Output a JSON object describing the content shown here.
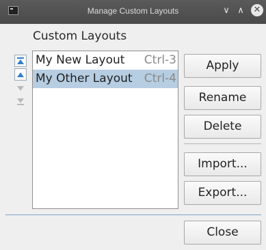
{
  "window": {
    "title": "Manage Custom Layouts",
    "minimize_glyph": "∨",
    "maximize_glyph": "∧",
    "close_glyph": "✕"
  },
  "heading": "Custom Layouts",
  "layouts": [
    {
      "name": "My New Layout",
      "shortcut": "Ctrl-3",
      "selected": false
    },
    {
      "name": "My Other Layout",
      "shortcut": "Ctrl-4",
      "selected": true
    }
  ],
  "buttons": {
    "apply": "Apply",
    "rename": "Rename",
    "delete": "Delete",
    "import": "Import...",
    "export": "Export...",
    "close": "Close"
  },
  "colors": {
    "selection": "#b6cde2",
    "arrow_enabled": "#2f7fd0",
    "arrow_disabled": "#b9b9b9"
  },
  "icons": {
    "move_top": "move-to-top-icon",
    "move_up": "move-up-icon",
    "move_down": "move-down-icon",
    "move_bottom": "move-to-bottom-icon"
  }
}
